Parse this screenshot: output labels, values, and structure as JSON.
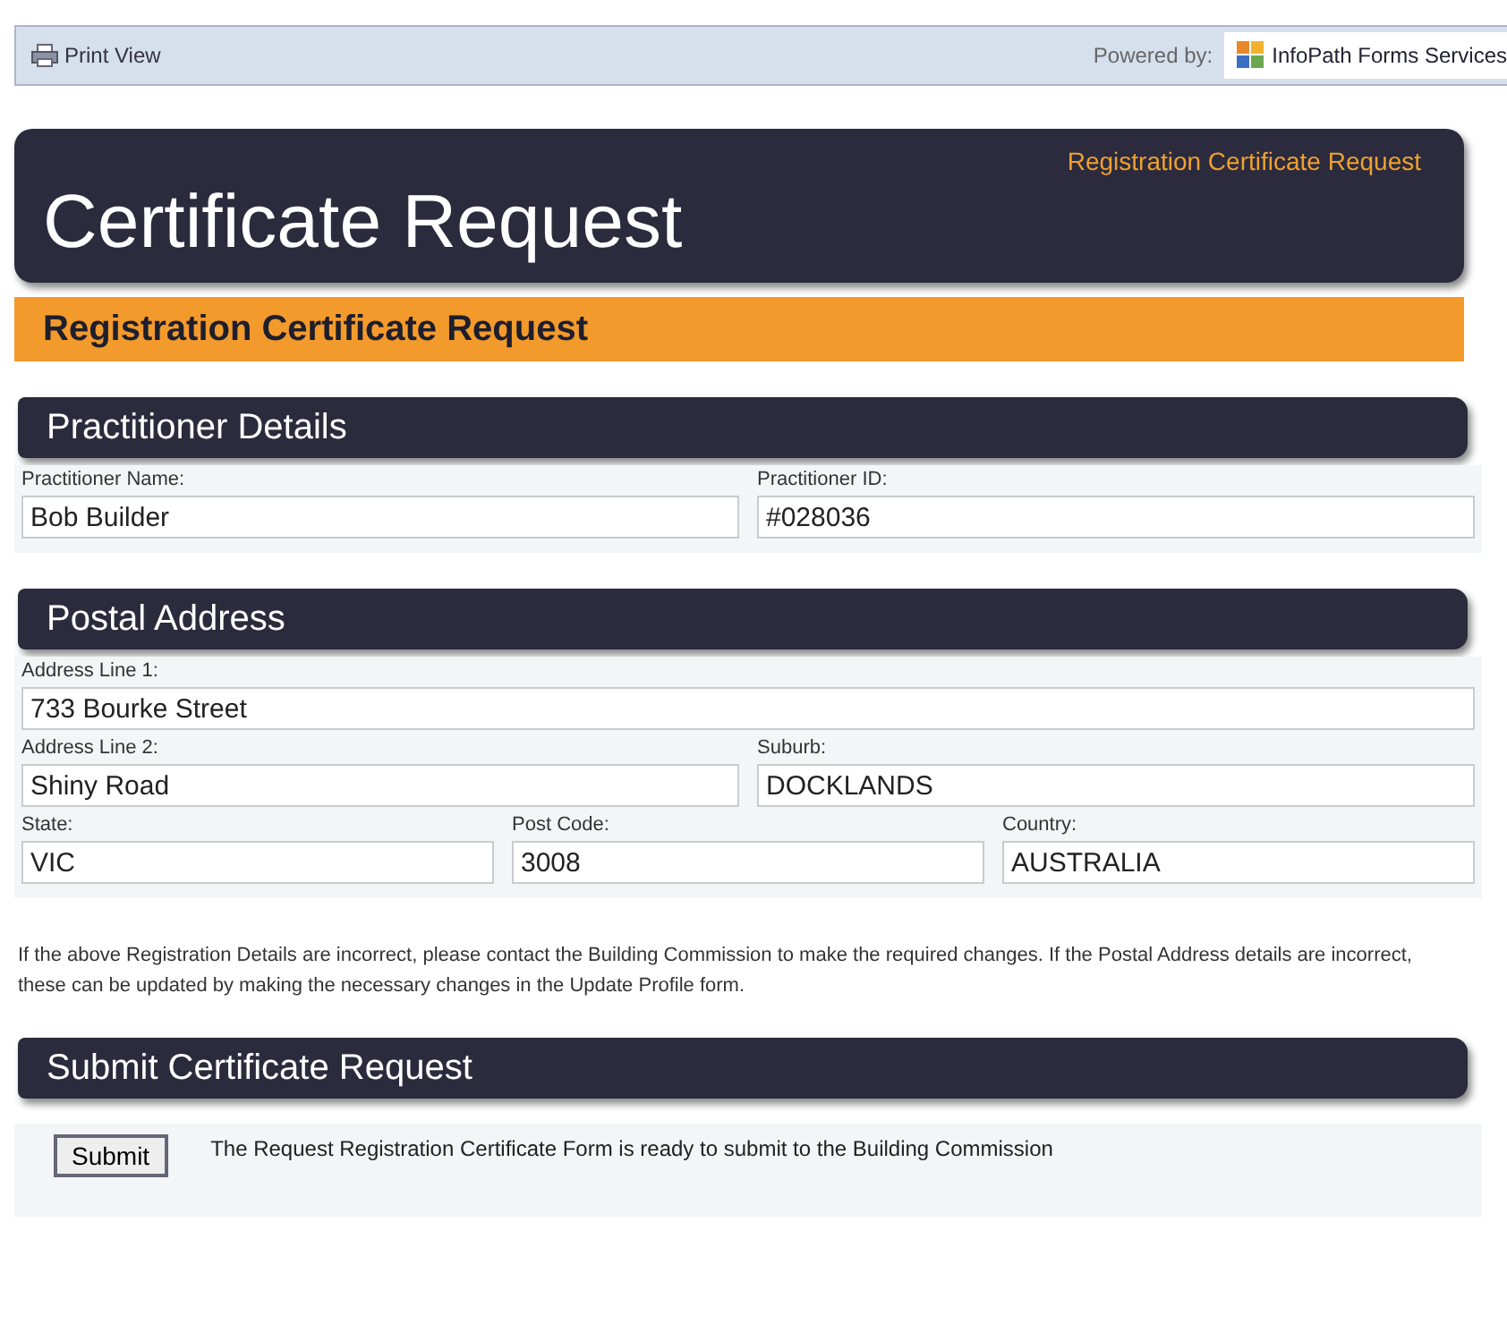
{
  "toolbar": {
    "print_view": "Print View",
    "powered_by": "Powered by:",
    "brand": "InfoPath Forms Services"
  },
  "header": {
    "title": "Certificate Request",
    "subtitle": "Registration Certificate Request"
  },
  "banner": "Registration Certificate Request",
  "sections": [
    {
      "title": "Practitioner Details",
      "rows": [
        [
          {
            "label": "Practitioner Name:",
            "value": "Bob Builder"
          },
          {
            "label": "Practitioner ID:",
            "value": "#028036"
          }
        ]
      ]
    },
    {
      "title": "Postal Address",
      "rows": [
        [
          {
            "label": "Address Line 1:",
            "value": "733 Bourke Street"
          }
        ],
        [
          {
            "label": "Address Line 2:",
            "value": "Shiny Road"
          },
          {
            "label": "Suburb:",
            "value": "DOCKLANDS"
          }
        ],
        [
          {
            "label": "State:",
            "value": "VIC"
          },
          {
            "label": "Post Code:",
            "value": "3008"
          },
          {
            "label": "Country:",
            "value": "AUSTRALIA"
          }
        ]
      ]
    }
  ],
  "note": "If the above Registration Details are incorrect, please contact the Building Commission to make the required changes.  If the Postal Address details are incorrect, these can be updated by making the necessary changes in the Update Profile form.",
  "submit": {
    "title": "Submit Certificate Request",
    "button": "Submit",
    "message": "The Request Registration Certificate Form is ready to submit to the Building Commission"
  }
}
